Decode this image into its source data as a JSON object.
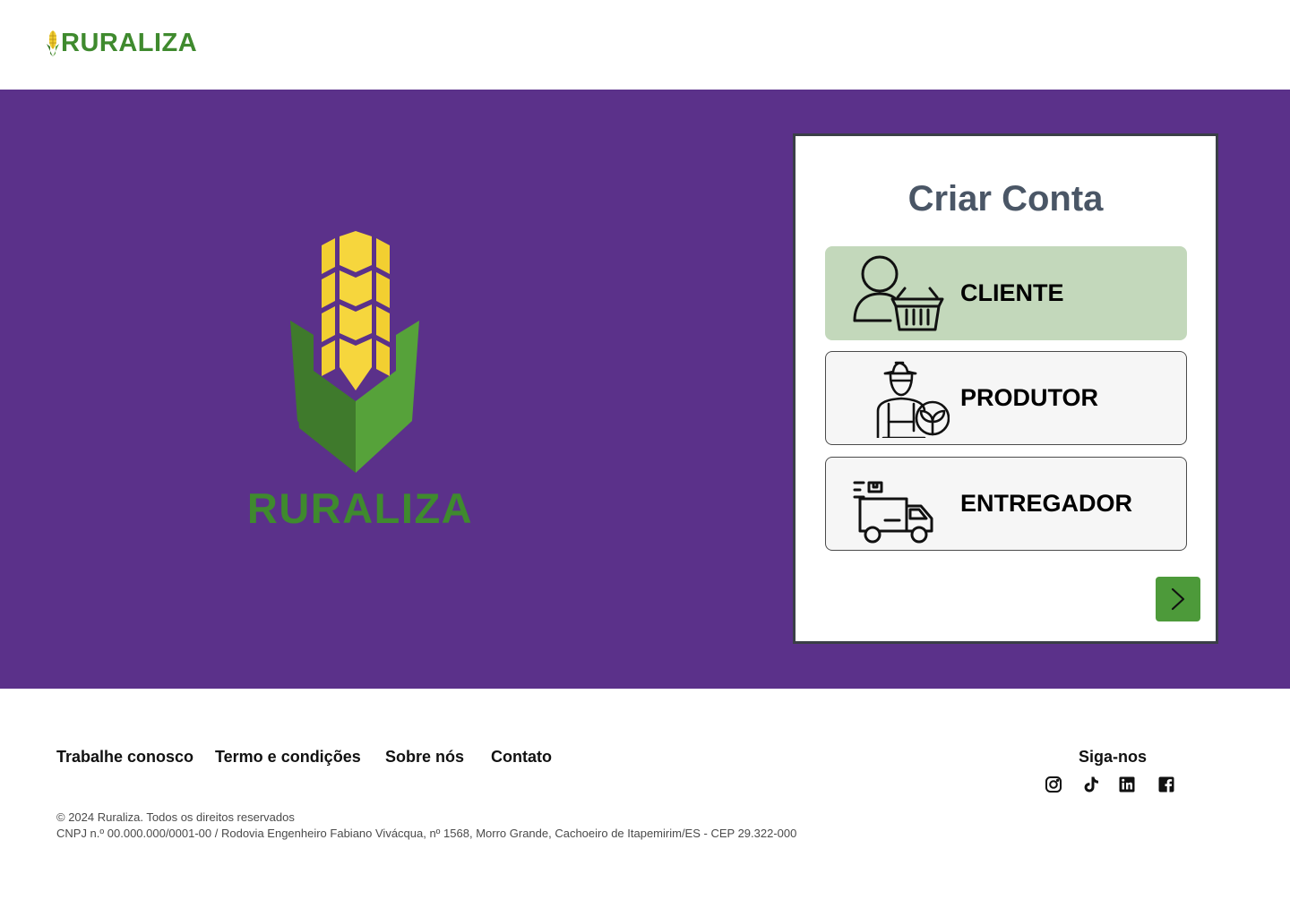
{
  "header": {
    "brand": "RURALIZA",
    "logo_icon": "corn-icon"
  },
  "hero": {
    "brand": "RURALIZA",
    "logo_icon": "corn-icon"
  },
  "signup": {
    "title": "Criar Conta",
    "selected_role": "cliente",
    "roles": [
      {
        "id": "cliente",
        "label": "CLIENTE",
        "icon": "customer-basket-icon",
        "selected": true
      },
      {
        "id": "produtor",
        "label": "PRODUTOR",
        "icon": "farmer-icon",
        "selected": false
      },
      {
        "id": "entregador",
        "label": "ENTREGADOR",
        "icon": "delivery-truck-icon",
        "selected": false
      }
    ],
    "next_icon": "chevron-right-icon"
  },
  "footer": {
    "links": [
      "Trabalhe conosco",
      "Termo e condições",
      "Sobre nós",
      "Contato"
    ],
    "follow_label": "Siga-nos",
    "social": [
      "instagram-icon",
      "tiktok-icon",
      "linkedin-icon",
      "facebook-icon"
    ],
    "copyright": "© 2024 Ruraliza. Todos os direitos reservados",
    "address": "CNPJ n.º 00.000.000/0001-00 / Rodovia Engenheiro Fabiano Vivácqua, nº 1568, Morro Grande, Cachoeiro de Itapemirim/ES - CEP 29.322-000"
  },
  "colors": {
    "hero_bg": "#5b318a",
    "brand_green": "#3f8a2e",
    "corn_yellow": "#f2cf31",
    "selected_role_bg": "#c3d8bb",
    "next_button": "#4d9a3a",
    "title_gray": "#4a5666"
  }
}
